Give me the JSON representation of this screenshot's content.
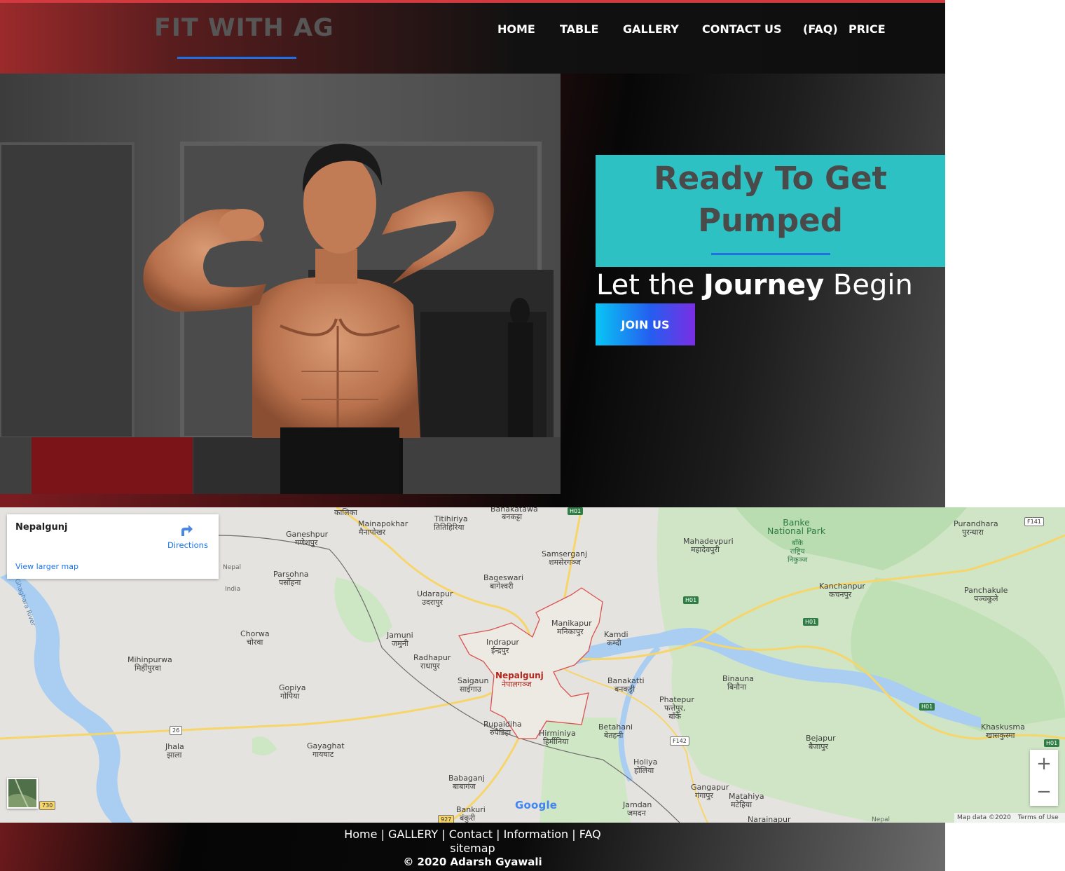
{
  "header": {
    "logo": "FIT WITH AG",
    "nav": [
      "HOME",
      "TABLE",
      "GALLERY",
      "CONTACT US",
      "(FAQ)",
      "PRICE"
    ]
  },
  "hero": {
    "title": "Ready To Get Pumped",
    "subtitle_pre": "Let the ",
    "subtitle_bold": "Journey",
    "subtitle_post": " Begin",
    "cta": "JOIN US"
  },
  "map": {
    "place": "Nepalgunj",
    "directions": "Directions",
    "larger_map": "View larger map",
    "zoom_in": "+",
    "zoom_out": "−",
    "map_data": "Map data ©2020",
    "terms": "Terms of Use",
    "logo": "Google",
    "labels": {
      "kalika": "कालिका",
      "mainapokhar": "Mainapokhar",
      "mainapokhar_np": "मैनापोखर",
      "titihiriya": "Titihiriya",
      "titihiriya_np": "तितिहिरिया",
      "banakatawa": "Banakatawa",
      "banakatawa_np": "बनकट्टा",
      "ganeshpur": "Ganeshpur",
      "ganeshpur_np": "गणेशपुर",
      "banke": "Banke\nNational Park",
      "banke_np": "बाँके\nराष्ट्रिय\nनिकुञ्ज",
      "purandhara": "Purandhara",
      "purandhara_np": "पुरन्धारा",
      "mahadevpuri": "Mahadevpuri",
      "mahadevpuri_np": "महादेवपुरी",
      "samserganj": "Samserganj",
      "samserganj_np": "शमसेरगञ्ज",
      "nepal": "Nepal",
      "india": "India",
      "parsohna": "Parsohna",
      "parsohna_np": "पर्सोहना",
      "bageswari": "Bageswari",
      "bageswari_np": "बागेश्वरी",
      "kanchanpur": "Kanchanpur",
      "kanchanpur_np": "कचनपुर",
      "panchakule": "Panchakule",
      "panchakule_np": "पञ्चकुले",
      "udarapur": "Udarapur",
      "udarapur_np": "उदरापुर",
      "ghaghara": "Ghaghara River",
      "chorwa": "Chorwa",
      "chorwa_np": "चोरवा",
      "jamuni": "Jamuni",
      "jamuni_np": "जमुनी",
      "manikapur": "Manikapur",
      "manikapur_np": "मनिकापुर",
      "kamdi": "Kamdi",
      "kamdi_np": "कम्दी",
      "indrapur": "Indrapur",
      "indrapur_np": "ईन्द्रपुर",
      "mihinpurwa": "Mihinpurwa",
      "mihinpurwa_np": "मिहींपुरवा",
      "radhapur": "Radhapur",
      "radhapur_np": "राधापुर",
      "saigaun": "Saigaun",
      "saigaun_np": "साईगाउ",
      "nepalgunj": "Nepalgunj",
      "nepalgunj_np": "नेपालगञ्ज",
      "banakatti": "Banakatti",
      "banakatti_np": "बनकट्टी",
      "binauna": "Binauna",
      "binauna_np": "बिनौना",
      "gopiya": "Gopiya",
      "gopiya_np": "गोपिया",
      "phatepur": "Phatepur",
      "phatepur_np": "फत्तेपुर,\nबाँके",
      "rupaidiha": "Rupaidiha",
      "rupaidiha_np": "रुपैडिहा",
      "betahani": "Betahani",
      "betahani_np": "बेतहनी",
      "hirminiya": "Hirminiya",
      "hirminiya_np": "हिर्मीनिया",
      "khaskusma": "Khaskusma",
      "khaskusma_np": "खासकुस्मा",
      "jhala": "Jhala",
      "jhala_np": "झाला",
      "gayaghat": "Gayaghat",
      "gayaghat_np": "गायघाट",
      "bejapur": "Bejapur",
      "bejapur_np": "बैजापुर",
      "holiya": "Holiya",
      "holiya_np": "होलिया",
      "babaganj": "Babaganj",
      "babaganj_np": "बाबागंज",
      "gangapur": "Gangapur",
      "gangapur_np": "गंगापुर",
      "matahiya": "Matahiya",
      "matahiya_np": "मटेहिया",
      "bankuri": "Bankuri",
      "bankuri_np": "बंकुरी",
      "jamdan": "Jamdan",
      "jamdan_np": "जमदन",
      "narainapur": "Narainapur",
      "nepal_b": "Nepal"
    },
    "roads": {
      "h01a": "H01",
      "h01b": "H01",
      "h01c": "H01",
      "h01d": "H01",
      "h01e": "H01",
      "f141": "F141",
      "f142": "F142",
      "r26": "26",
      "r730": "730",
      "r927": "927"
    }
  },
  "footer": {
    "links": [
      "Home",
      "GALLERY",
      "Contact",
      "Information",
      "FAQ"
    ],
    "separator": " | ",
    "sitemap": "sitemap",
    "copyright": "© 2020 Adarsh Gyawali"
  },
  "colors": {
    "accent_teal": "#2ec1c3",
    "accent_blue": "#1f6fe5",
    "header_red": "#9b2a2b"
  }
}
